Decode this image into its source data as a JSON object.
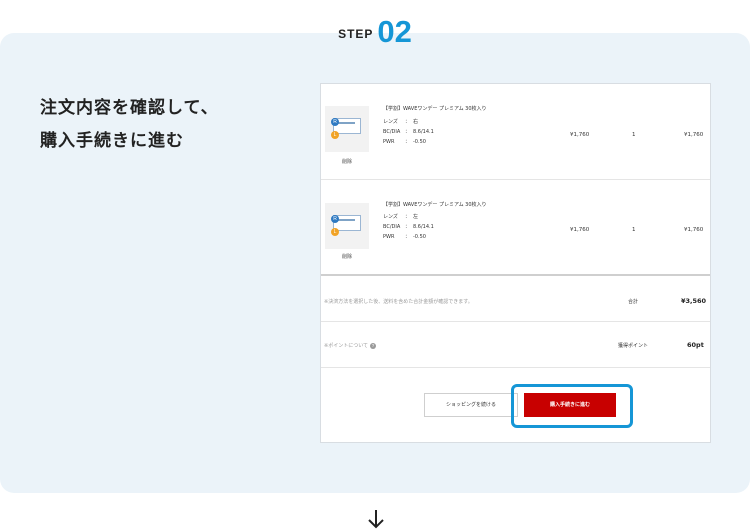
{
  "step": {
    "label": "STEP",
    "number": "02"
  },
  "instruction": {
    "line1": "注文内容を確認して、",
    "line2": "購入手続きに進む"
  },
  "cart": {
    "items": [
      {
        "name": "【学割】WAVEワンデー プレミアム 30枚入り",
        "lens_label": "レンズ",
        "lens_value": "右",
        "bc_label": "BC/DIA",
        "bc_value": "8.6/14.1",
        "pwr_label": "PWR",
        "pwr_value": "-0.50",
        "price": "¥1,760",
        "qty": "1",
        "subtotal": "¥1,760",
        "delete_label": "削除"
      },
      {
        "name": "【学割】WAVEワンデー プレミアム 30枚入り",
        "lens_label": "レンズ",
        "lens_value": "左",
        "bc_label": "BC/DIA",
        "bc_value": "8.6/14.1",
        "pwr_label": "PWR",
        "pwr_value": "-0.50",
        "price": "¥1,760",
        "qty": "1",
        "subtotal": "¥1,760",
        "delete_label": "削除"
      }
    ],
    "separator": "：",
    "icon_right": "R",
    "icon_left": "L",
    "total_note": "※決済方法を選択した後、送料を含めた合計金額が確認できます。",
    "total_label": "合計",
    "total_value": "¥3,560",
    "point_note": "※ポイントについて",
    "point_label": "獲得ポイント",
    "point_value": "60pt",
    "continue_button": "ショッピングを続ける",
    "proceed_button": "購入手続きに進む"
  },
  "colors": {
    "accent": "#1596d6",
    "panel_bg": "#ebf3f9",
    "proceed_bg": "#c80000"
  },
  "icons": {
    "help": "question-icon",
    "arrow": "arrow-down-icon"
  }
}
